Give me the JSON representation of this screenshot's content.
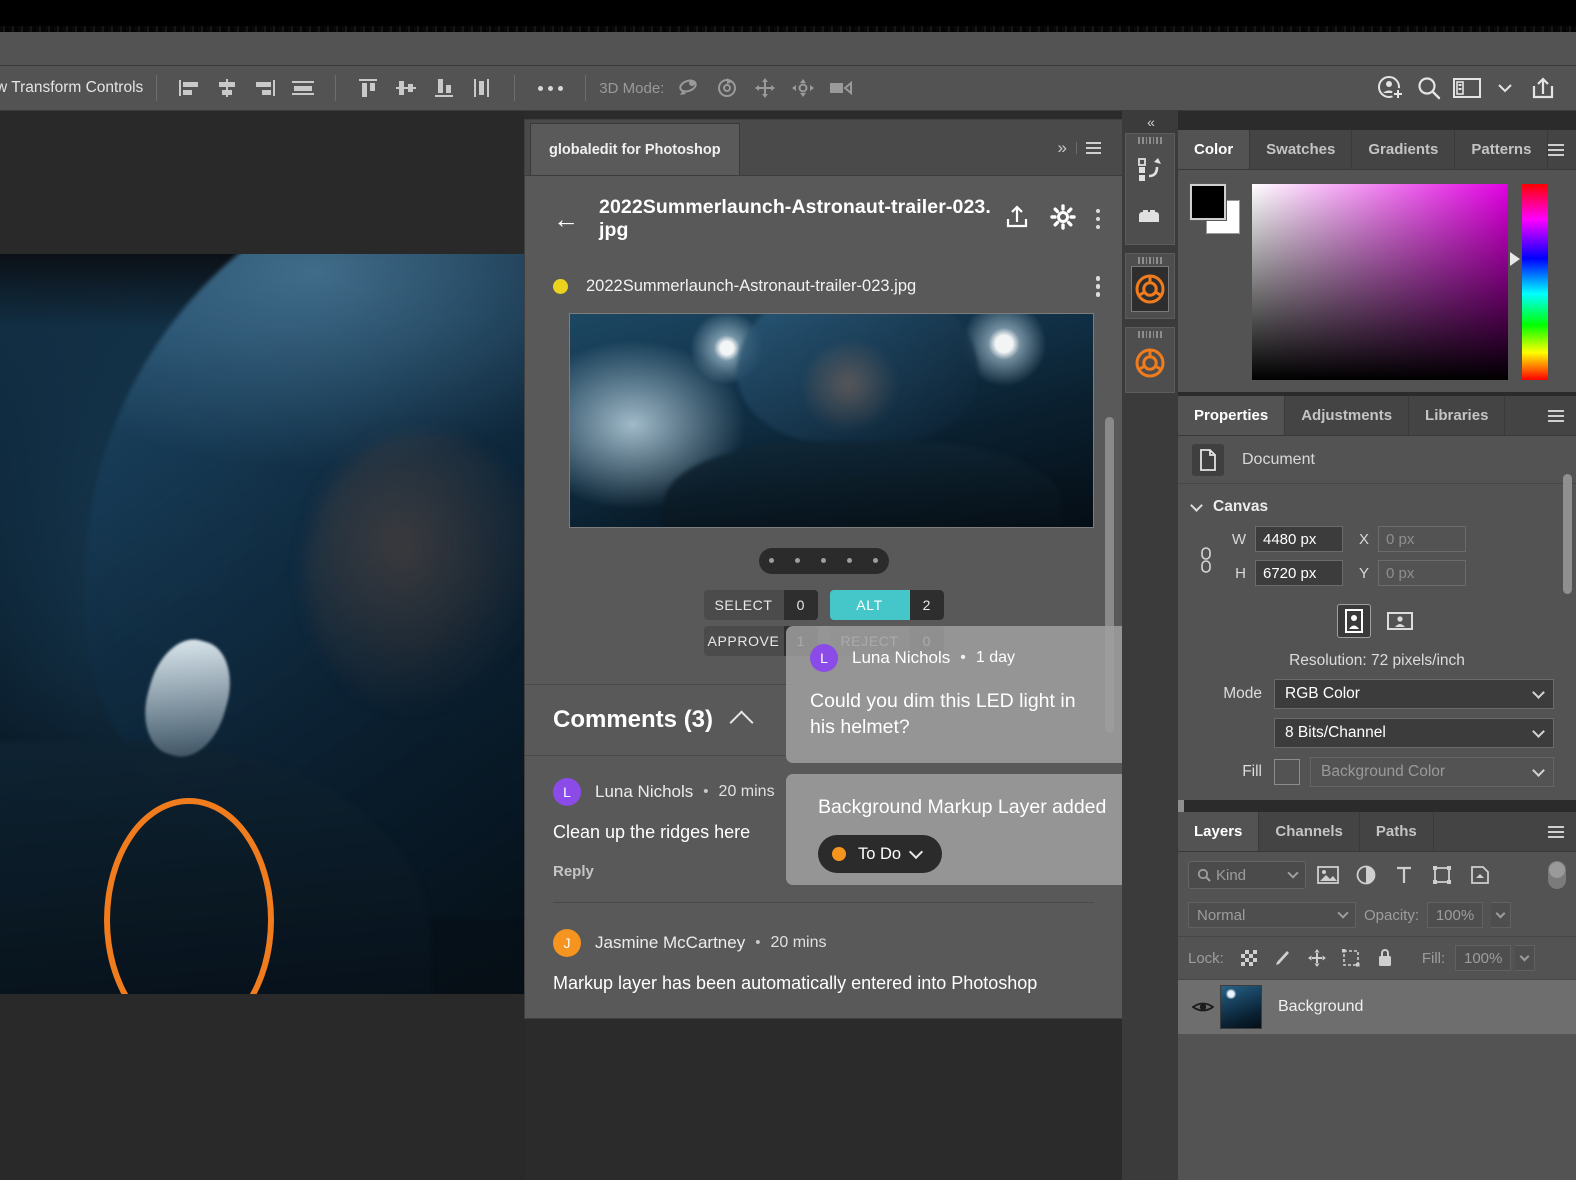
{
  "optionbar": {
    "transform_controls_label": "w Transform Controls",
    "mode3d_label": "3D Mode:",
    "align_icons": [
      "align-left-edges-icon",
      "align-horizontal-centers-icon",
      "align-right-edges-icon",
      "distribute-horizontal-icon"
    ],
    "align_icons2": [
      "align-top-edges-icon",
      "align-vertical-centers-icon",
      "align-bottom-edges-icon",
      "distribute-vertical-icon"
    ],
    "more_label": "•••",
    "mode3d_icons": [
      "3d-orbit-icon",
      "3d-roll-icon",
      "3d-pan-icon",
      "3d-slide-icon",
      "3d-camera-icon"
    ],
    "right_icons": [
      "add-user-icon",
      "search-icon",
      "workspace-icon",
      "chevron-down-icon",
      "share-icon"
    ]
  },
  "globaledit": {
    "tab_label": "globaledit for Photoshop",
    "expand_icon": "chevron-double-right-icon",
    "menu_icon": "panel-menu-icon",
    "back_icon": "back-arrow-icon",
    "header_title": "2022Summerlaunch-Astronaut-trailer-023. jpg",
    "header_icons": [
      "upload-icon",
      "settings-gear-icon",
      "more-vertical-icon"
    ],
    "file": {
      "status_color": "#EBD21E",
      "name": "2022Summerlaunch-Astronaut-trailer-023.jpg",
      "kebab_icon": "more-vertical-icon"
    },
    "carousel_dots": 5,
    "ratings": [
      {
        "label": "SELECT",
        "count": "0",
        "active": false
      },
      {
        "label": "ALT",
        "count": "2",
        "active": true
      },
      {
        "label": "APPROVE",
        "count": "1",
        "active": false
      },
      {
        "label": "REJECT",
        "count": "0",
        "active": false
      }
    ],
    "accent_color": "#45C6C9",
    "comments_header": "Comments (3)",
    "collapse_icon": "chevron-up-icon",
    "comments": [
      {
        "initial": "L",
        "avatar_color": "#8B4BE8",
        "name": "Luna Nichols",
        "separator": "•",
        "time": "20 mins",
        "text": "Clean up the ridges here",
        "reply_label": "Reply"
      },
      {
        "initial": "J",
        "avatar_color": "#F5941E",
        "name": "Jasmine McCartney",
        "separator": "•",
        "time": "20 mins",
        "text": "Markup layer has been automatically entered into Photoshop",
        "reply_label": ""
      }
    ]
  },
  "floating_cards": {
    "luna": {
      "initial": "L",
      "avatar_color": "#8B4BE8",
      "name": "Luna Nichols",
      "separator": "•",
      "time": "1 day",
      "text": "Could you dim this LED light in his helmet?",
      "kebab_icon": "more-vertical-icon"
    },
    "markup": {
      "title": "Background Markup Layer added",
      "status_label": "To Do",
      "status_color": "#F5941E",
      "chevron_icon": "chevron-down-icon"
    }
  },
  "dock": {
    "collapse_icon": "chevron-double-left-icon",
    "items": [
      {
        "icon": "history-icon",
        "selected": false
      },
      {
        "icon": "libraries-icon",
        "selected": false
      },
      {
        "icon": "globaledit-aperture-icon",
        "selected": true
      },
      {
        "icon": "globaledit-aperture-icon",
        "selected": false
      }
    ],
    "accent_color": "#F07C1E"
  },
  "color_panel": {
    "tabs": [
      "Color",
      "Swatches",
      "Gradients",
      "Patterns"
    ],
    "active_tab": "Color",
    "menu_icon": "panel-menu-icon",
    "foreground": "#000000",
    "background": "#ffffff",
    "picker_icon": "color-field-icon",
    "hue_slider_icon": "hue-slider-icon"
  },
  "properties_panel": {
    "tabs": [
      "Properties",
      "Adjustments",
      "Libraries"
    ],
    "active_tab": "Properties",
    "menu_icon": "panel-menu-icon",
    "document_label": "Document",
    "document_icon": "document-icon",
    "section_title": "Canvas",
    "link_icon": "link-dimensions-icon",
    "width_label": "W",
    "width_value": "4480 px",
    "x_label": "X",
    "x_placeholder": "0 px",
    "height_label": "H",
    "height_value": "6720 px",
    "y_label": "Y",
    "y_placeholder": "0 px",
    "orientation_portrait_icon": "portrait-orientation-icon",
    "orientation_landscape_icon": "landscape-orientation-icon",
    "resolution_text": "Resolution: 72 pixels/inch",
    "mode_label": "Mode",
    "mode_value": "RGB Color",
    "bits_value": "8 Bits/Channel",
    "fill_label": "Fill",
    "fill_value": "Background Color"
  },
  "layers_panel": {
    "tabs": [
      "Layers",
      "Channels",
      "Paths"
    ],
    "active_tab": "Layers",
    "menu_icon": "panel-menu-icon",
    "kind_label": "Kind",
    "search_icon": "search-icon",
    "filter_icons": [
      "pixel-layer-filter-icon",
      "adjustment-layer-filter-icon",
      "type-layer-filter-icon",
      "shape-layer-filter-icon",
      "smart-object-filter-icon"
    ],
    "filter_toggle_icon": "filter-toggle-icon",
    "blend_mode": "Normal",
    "opacity_label": "Opacity:",
    "opacity_value": "100%",
    "lock_label": "Lock:",
    "lock_icons": [
      "lock-transparent-pixels-icon",
      "lock-image-pixels-icon",
      "lock-position-icon",
      "lock-artboard-icon",
      "lock-all-icon"
    ],
    "fill_label": "Fill:",
    "fill_value": "100%",
    "layers": [
      {
        "name": "Background",
        "visible": true,
        "eye_icon": "eye-icon"
      }
    ]
  },
  "canvas": {
    "markup_color": "#F07C1E",
    "markup_shape": "circle-annotation"
  }
}
